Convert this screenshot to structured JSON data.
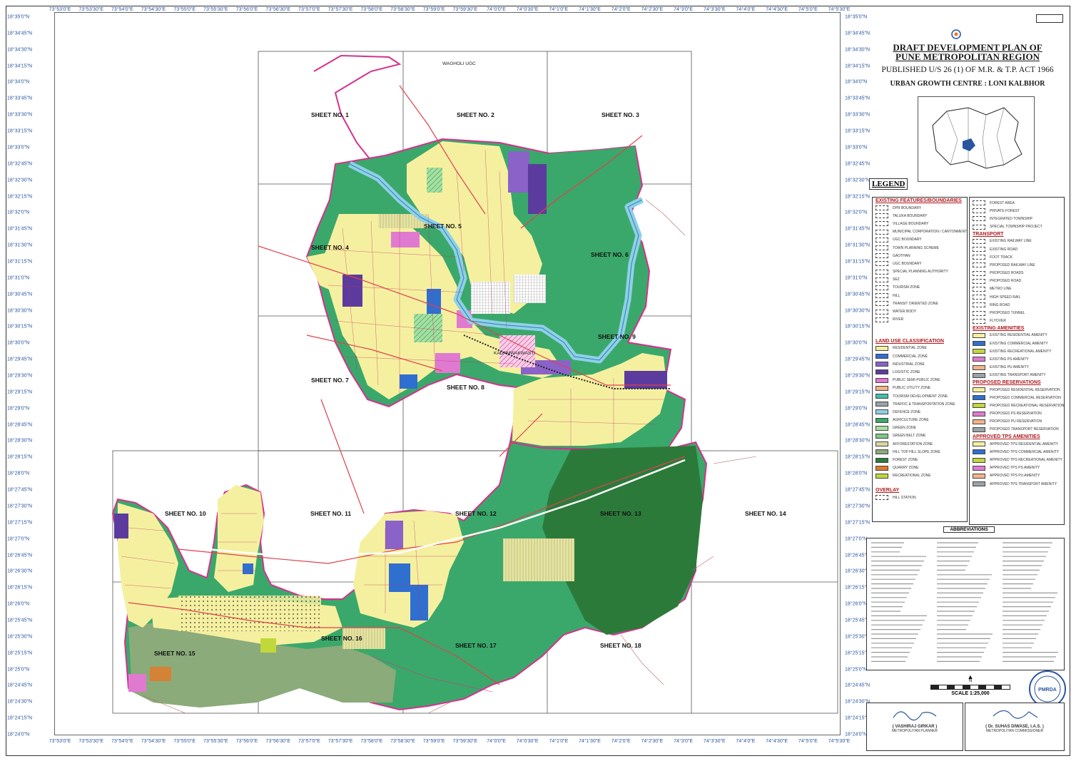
{
  "title": {
    "line1": "DRAFT DEVELOPMENT PLAN OF",
    "line2": "PUNE METROPOLITAN REGION",
    "published": "PUBLISHED U/S 26 (1) OF M.R. & T.P. ACT 1966",
    "ugc": "URBAN GROWTH CENTRE : LONI KALBHOR"
  },
  "legend_title": "LEGEND",
  "coords": {
    "top": [
      "73°53'0\"E",
      "73°53'30\"E",
      "73°54'0\"E",
      "73°54'30\"E",
      "73°55'0\"E",
      "73°55'30\"E",
      "73°56'0\"E",
      "73°56'30\"E",
      "73°57'0\"E",
      "73°57'30\"E",
      "73°58'0\"E",
      "73°58'30\"E",
      "73°59'0\"E",
      "73°59'30\"E",
      "74°0'0\"E",
      "74°0'30\"E",
      "74°1'0\"E",
      "74°1'30\"E",
      "74°2'0\"E",
      "74°2'30\"E",
      "74°3'0\"E",
      "74°3'30\"E",
      "74°4'0\"E",
      "74°4'30\"E",
      "74°5'0\"E",
      "74°5'30\"E"
    ],
    "bottom": [
      "73°53'0\"E",
      "73°53'30\"E",
      "73°54'0\"E",
      "73°54'30\"E",
      "73°55'0\"E",
      "73°55'30\"E",
      "73°56'0\"E",
      "73°56'30\"E",
      "73°57'0\"E",
      "73°57'30\"E",
      "73°58'0\"E",
      "73°58'30\"E",
      "73°59'0\"E",
      "73°59'30\"E",
      "74°0'0\"E",
      "74°0'30\"E",
      "74°1'0\"E",
      "74°1'30\"E",
      "74°2'0\"E",
      "74°2'30\"E",
      "74°3'0\"E",
      "74°3'30\"E",
      "74°4'0\"E",
      "74°4'30\"E",
      "74°5'0\"E",
      "74°5'30\"E"
    ],
    "lat": [
      "18°35'0\"N",
      "18°34'45\"N",
      "18°34'30\"N",
      "18°34'15\"N",
      "18°34'0\"N",
      "18°33'45\"N",
      "18°33'30\"N",
      "18°33'15\"N",
      "18°33'0\"N",
      "18°32'45\"N",
      "18°32'30\"N",
      "18°32'15\"N",
      "18°32'0\"N",
      "18°31'45\"N",
      "18°31'30\"N",
      "18°31'15\"N",
      "18°31'0\"N",
      "18°30'45\"N",
      "18°30'30\"N",
      "18°30'15\"N",
      "18°30'0\"N",
      "18°29'45\"N",
      "18°29'30\"N",
      "18°29'15\"N",
      "18°29'0\"N",
      "18°28'45\"N",
      "18°28'30\"N",
      "18°28'15\"N",
      "18°28'0\"N",
      "18°27'45\"N",
      "18°27'30\"N",
      "18°27'15\"N",
      "18°27'0\"N",
      "18°26'45\"N",
      "18°26'30\"N",
      "18°26'15\"N",
      "18°26'0\"N",
      "18°25'45\"N",
      "18°25'30\"N",
      "18°25'15\"N",
      "18°25'0\"N",
      "18°24'45\"N",
      "18°24'30\"N",
      "18°24'15\"N",
      "18°24'0\"N"
    ]
  },
  "sheets": [
    "SHEET NO. 1",
    "SHEET NO. 2",
    "SHEET NO. 3",
    "SHEET NO. 4",
    "SHEET NO. 5",
    "SHEET NO. 6",
    "SHEET NO. 7",
    "SHEET NO. 8",
    "SHEET NO. 9",
    "SHEET NO. 10",
    "SHEET NO. 11",
    "SHEET NO. 12",
    "SHEET NO. 13",
    "SHEET NO. 14",
    "SHEET NO. 15",
    "SHEET NO. 16",
    "SHEET NO. 17",
    "SHEET NO. 18"
  ],
  "places": {
    "wagholi": "WAGHOLI UGC",
    "kadamwakwasti": "KADAMWAKWASTI"
  },
  "legend": {
    "existing_features": {
      "heading": "EXISTING FEATURES/BOUNDARIES",
      "items": [
        "DPR BOUNDARY",
        "TALUKA BOUNDARY",
        "VILLAGE BOUNDARY",
        "MUNICIPAL CORPORATION / CANTONMENT BOUNDARY",
        "UGC BOUNDARY",
        "TOWN PLANNING SCHEME",
        "GAOTHAN",
        "UGC BOUNDARY",
        "SPECIAL PLANNING AUTHORITY",
        "SEZ",
        "TOURISM ZONE",
        "HILL",
        "TRANSIT ORIENTED ZONE",
        "WATER BODY",
        "RIVER"
      ]
    },
    "land_use": {
      "heading": "LAND USE CLASSIFICATION",
      "items": [
        {
          "label": "RESIDENTIAL ZONE",
          "color": "#f5f0a0"
        },
        {
          "label": "COMMERCIAL ZONE",
          "color": "#2f6fd0"
        },
        {
          "label": "INDUSTRIAL ZONE",
          "color": "#8a62c8"
        },
        {
          "label": "LOGISTIC ZONE",
          "color": "#5b3c9e"
        },
        {
          "label": "PUBLIC SEMI-PUBLIC ZONE",
          "color": "#e07ad0"
        },
        {
          "label": "PUBLIC UTILITY ZONE",
          "color": "#f2b48a"
        },
        {
          "label": "TOURISM DEVELOPMENT ZONE",
          "color": "#3fbfb0"
        },
        {
          "label": "TRAFFIC & TRANSPORTATION ZONE",
          "color": "#9aa3a8"
        },
        {
          "label": "DEFENCE ZONE",
          "color": "#8fd0e8"
        },
        {
          "label": "AGRICULTURE ZONE",
          "color": "#3aa86a"
        },
        {
          "label": "GREEN ZONE",
          "color": "#a8e0a0"
        },
        {
          "label": "GREEN BELT ZONE",
          "color": "#7cc88a"
        },
        {
          "label": "AFFORESTATION ZONE",
          "color": "#d8d8a0"
        },
        {
          "label": "HILL TOP HILL SLOPE ZONE",
          "color": "#8bab7a"
        },
        {
          "label": "FOREST ZONE",
          "color": "#2c7a3a"
        },
        {
          "label": "QUARRY ZONE",
          "color": "#e07a2a"
        },
        {
          "label": "RECREATIONAL ZONE",
          "color": "#c0d83a"
        }
      ]
    },
    "overlay": {
      "heading": "OVERLAY",
      "items": [
        "HILL STATION"
      ]
    },
    "right": {
      "top_items": [
        "FOREST AREA",
        "PRIVATE FOREST",
        "INTEGRATED TOWNSHIP",
        "SPECIAL TOWNSHIP PROJECT"
      ],
      "transport_heading": "TRANSPORT",
      "transport_items": [
        "EXISTING RAILWAY LINE",
        "EXISTING ROAD",
        "FOOT TRACK",
        "PROPOSED RAILWAY LINE",
        "PROPOSED ROADS",
        "PROPOSED ROAD",
        "METRO LINE",
        "HIGH SPEED RAIL",
        "RING ROAD",
        "PROPOSED TUNNEL",
        "FLYOVER"
      ],
      "amenities_heading": "EXISTING AMENITIES",
      "amenities": [
        {
          "label": "EXISTING RESIDENTIAL AMENITY",
          "color": "#f5f0a0"
        },
        {
          "label": "EXISTING COMMERCIAL AMENITY",
          "color": "#2f6fd0"
        },
        {
          "label": "EXISTING RECREATIONAL AMENITY",
          "color": "#c0d83a"
        },
        {
          "label": "EXISTING PS AMENITY",
          "color": "#e07ad0"
        },
        {
          "label": "EXISTING PU AMENITY",
          "color": "#f2b48a"
        },
        {
          "label": "EXISTING TRANSPORT AMENITY",
          "color": "#9aa3a8"
        }
      ],
      "reservations_heading": "PROPOSED RESERVATIONS",
      "reservations": [
        {
          "label": "PROPOSED RESIDENTIAL RESERVATION",
          "color": "#f5f0a0"
        },
        {
          "label": "PROPOSED COMMERCIAL RESERVATION",
          "color": "#2f6fd0"
        },
        {
          "label": "PROPOSED RECREATIONAL RESERVATION",
          "color": "#c0d83a"
        },
        {
          "label": "PROPOSED PS RESERVATION",
          "color": "#e07ad0"
        },
        {
          "label": "PROPOSED PU RESERVATION",
          "color": "#f2b48a"
        },
        {
          "label": "PROPOSED TRANSPORT RESERVATION",
          "color": "#9aa3a8"
        }
      ],
      "tps_heading": "APPROVED TPS AMENITIES",
      "tps": [
        {
          "label": "APPROVED TPS RESIDENTIAL AMENITY",
          "color": "#f5f0a0"
        },
        {
          "label": "APPROVED TPS COMMERCIAL AMENITY",
          "color": "#2f6fd0"
        },
        {
          "label": "APPROVED TPS RECREATIONAL AMENITY",
          "color": "#c0d83a"
        },
        {
          "label": "APPROVED TPS PS AMENITY",
          "color": "#e07ad0"
        },
        {
          "label": "APPROVED TPS PU AMENITY",
          "color": "#f2b48a"
        },
        {
          "label": "APPROVED TPS TRANSPORT AMENITY",
          "color": "#9aa3a8"
        }
      ]
    }
  },
  "abbreviations_title": "ABBREVIATIONS",
  "scale": {
    "north": "N",
    "label": "SCALE 1:25,000"
  },
  "signatures": {
    "left_name": "( VASHIRAJ GIRKAR )",
    "left_role": "METROPOLITAN PLANNER",
    "right_name": "( Dr. SUHAS DIWASE, I.A.S. )",
    "right_role": "METROPOLITAN COMMISSIONER",
    "seal": "PMRDA"
  },
  "colors": {
    "residential": "#f5f0a0",
    "agriculture": "#3aa86a",
    "forest": "#2c7a3a",
    "commercial": "#2f6fd0",
    "industrial": "#8a62c8",
    "public": "#e07ad0",
    "river": "#8fd0e8",
    "boundary": "#d6318c",
    "hill": "#8bab7a",
    "coord": "#2a55a0"
  }
}
